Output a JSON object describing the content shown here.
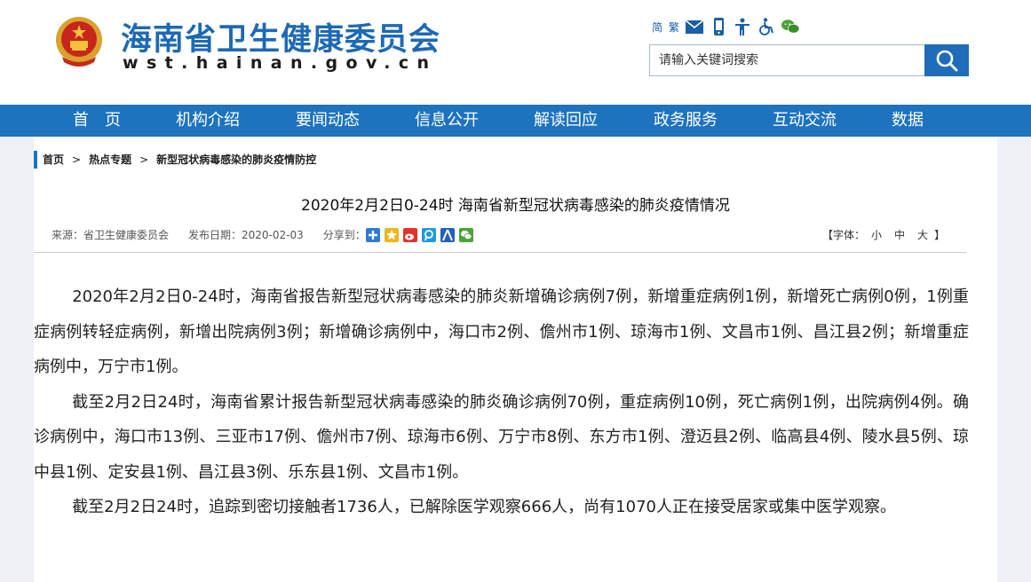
{
  "header": {
    "title": "海南省卫生健康委员会",
    "domain": "wst.hainan.gov.cn",
    "tools": {
      "simplified": "简",
      "traditional": "繁"
    },
    "search": {
      "placeholder": "请输入关键词搜索"
    }
  },
  "nav": {
    "items": [
      "首　页",
      "机构介绍",
      "要闻动态",
      "信息公开",
      "解读回应",
      "政务服务",
      "互动交流",
      "数据"
    ]
  },
  "breadcrumb": {
    "home": "首页",
    "sep": ">",
    "topic": "热点专题",
    "current": "新型冠状病毒感染的肺炎疫情防控"
  },
  "article": {
    "title": "2020年2月2日0-24时 海南省新型冠状病毒感染的肺炎疫情情况",
    "source": "来源：省卫生健康委员会",
    "date": "发布日期：2020-02-03",
    "share_label": "分享到：",
    "fontsize": {
      "label_open": "【字体：",
      "small": "小",
      "medium": "中",
      "large": "大",
      "label_close": "】"
    },
    "paragraphs": [
      "2020年2月2日0-24时，海南省报告新型冠状病毒感染的肺炎新增确诊病例7例，新增重症病例1例，新增死亡病例0例，1例重症病例转轻症病例，新增出院病例3例；新增确诊病例中，海口市2例、儋州市1例、琼海市1例、文昌市1例、昌江县2例；新增重症病例中，万宁市1例。",
      "截至2月2日24时，海南省累计报告新型冠状病毒感染的肺炎确诊病例70例，重症病例10例，死亡病例1例，出院病例4例。确诊病例中，海口市13例、三亚市17例、儋州市7例、琼海市6例、万宁市8例、东方市1例、澄迈县2例、临高县4例、陵水县5例、琼中县1例、定安县1例、昌江县3例、乐东县1例、文昌市1例。",
      "截至2月2日24时，追踪到密切接触者1736人，已解除医学观察666人，尚有1070人正在接受居家或集中医学观察。"
    ]
  },
  "colors": {
    "brand": "#1e69b4",
    "nav": "#1e73be",
    "search_button": "#1f6cba"
  },
  "icons": [
    "national-emblem-icon",
    "mail-icon",
    "mobile-icon",
    "accessibility-icon",
    "wheelchair-icon",
    "wechat-icon",
    "search-icon"
  ]
}
